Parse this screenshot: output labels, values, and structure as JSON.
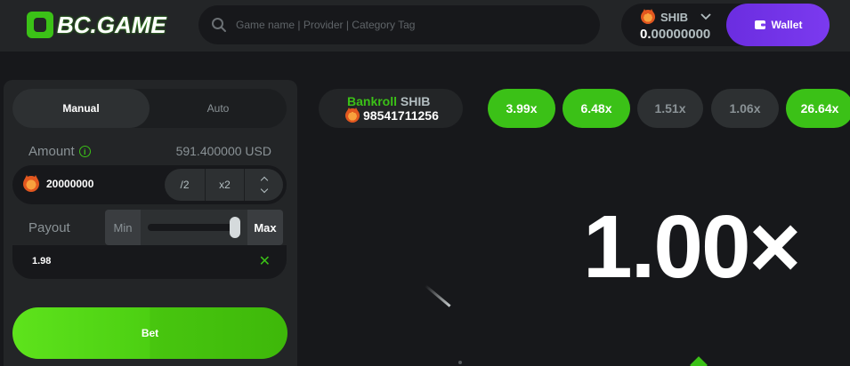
{
  "header": {
    "logo_text": "BC.GAME",
    "search_placeholder": "Game name | Provider | Category Tag",
    "currency": "SHIB",
    "balance_lead": "0.",
    "balance_rest": "00000000",
    "wallet_label": "Wallet"
  },
  "panel": {
    "tabs": [
      {
        "label": "Manual",
        "active": true
      },
      {
        "label": "Auto",
        "active": false
      }
    ],
    "amount_label": "Amount",
    "amount_usd": "591.400000 USD",
    "amount_value": "20000000",
    "half_label": "/2",
    "double_label": "x2",
    "payout_label": "Payout",
    "slider_min": "Min",
    "slider_max": "Max",
    "payout_value": "1.98",
    "bet_label": "Bet"
  },
  "game": {
    "bankroll_label": "Bankroll",
    "bankroll_currency": "SHIB",
    "bankroll_value": "98541711256",
    "history": [
      {
        "value": "3.99x",
        "win": true
      },
      {
        "value": "6.48x",
        "win": true
      },
      {
        "value": "1.51x",
        "win": false
      },
      {
        "value": "1.06x",
        "win": false
      },
      {
        "value": "26.64x",
        "win": true
      }
    ],
    "multiplier": "1.00×"
  },
  "colors": {
    "accent_green": "#3bc117",
    "wallet_purple": "#7b3aef",
    "background": "#17181b",
    "panel": "#232527"
  }
}
